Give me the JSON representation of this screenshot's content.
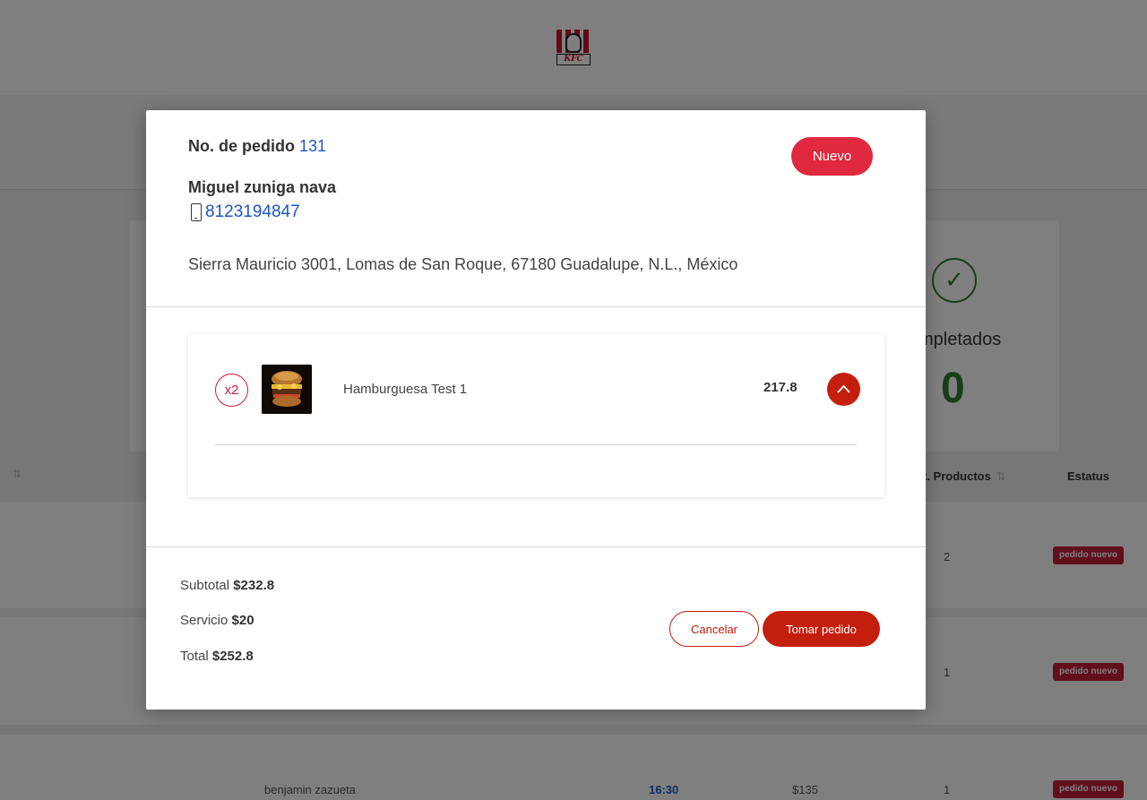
{
  "header": {
    "logo_text": "KFC"
  },
  "summary_card": {
    "label": "mpletados",
    "count": "0"
  },
  "table": {
    "headers": {
      "productos": "t. Productos",
      "estatus": "Estatus"
    },
    "rows": [
      {
        "customer": "",
        "time": "",
        "amount": "",
        "products": "2",
        "status": "pedido nuevo"
      },
      {
        "customer": "",
        "time": "",
        "amount": "",
        "products": "1",
        "status": "pedido nuevo"
      },
      {
        "customer": "benjamin zazueta",
        "time": "16:30",
        "amount": "$135",
        "products": "1",
        "status": "pedido nuevo"
      }
    ]
  },
  "modal": {
    "order_label": "No. de pedido",
    "order_number": "131",
    "status_button": "Nuevo",
    "customer_name": "Miguel zuniga nava",
    "phone": "8123194847",
    "address": "Sierra Mauricio 3001, Lomas de San Roque, 67180 Guadalupe, N.L., México",
    "items": [
      {
        "quantity": "x2",
        "name": "Hamburguesa Test 1",
        "price": "217.8"
      }
    ],
    "totals": {
      "subtotal_label": "Subtotal",
      "subtotal": "$232.8",
      "service_label": "Servicio",
      "service": "$20",
      "total_label": "Total",
      "total": "$252.8"
    },
    "buttons": {
      "cancel": "Cancelar",
      "take": "Tomar pedido"
    }
  },
  "colors": {
    "brand_red": "#c41e0e",
    "status_red": "#e0293f",
    "link_blue": "#1a56c4",
    "success_green": "#2e7d32"
  }
}
